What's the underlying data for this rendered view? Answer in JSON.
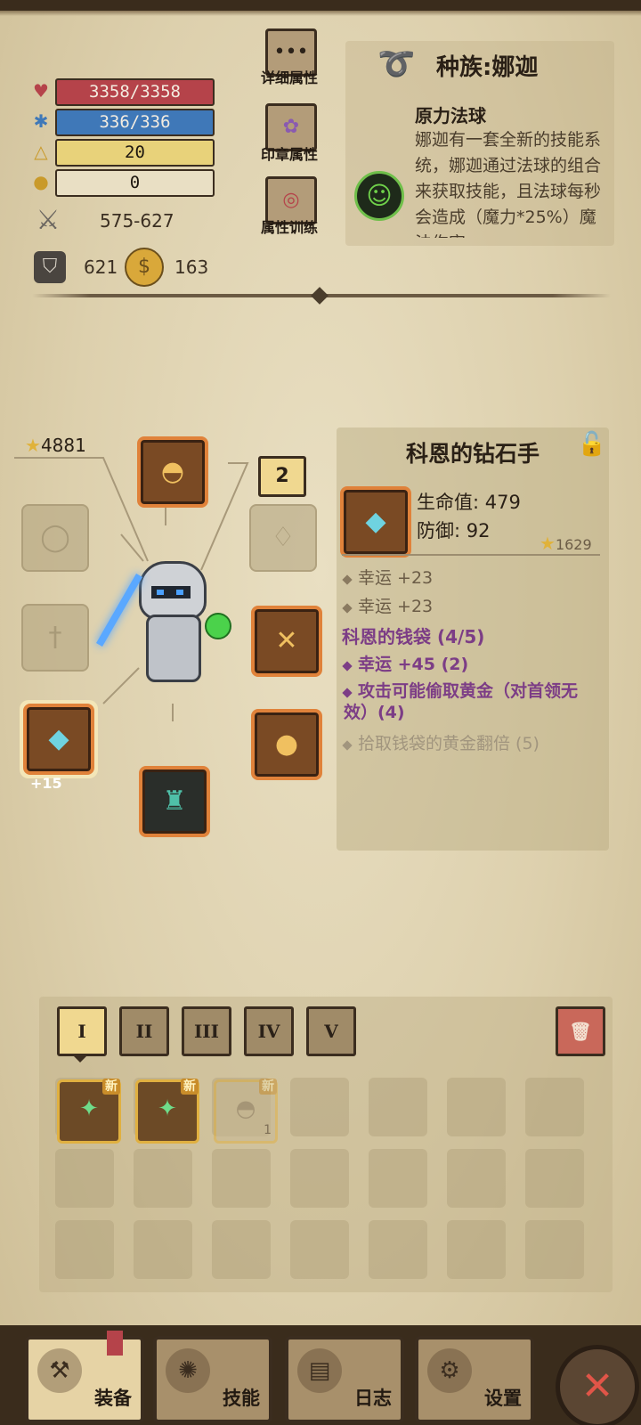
{
  "stats": {
    "hp": "3358/3358",
    "mp": "336/336",
    "level": "20",
    "points": "0",
    "attack": "575-627",
    "defense": "621",
    "gold": "163"
  },
  "actions": [
    {
      "label": "详细属性",
      "icon": "ellipsis-icon"
    },
    {
      "label": "印章属性",
      "icon": "rune-icon"
    },
    {
      "label": "属性训练",
      "icon": "target-icon"
    }
  ],
  "race": {
    "title": "种族:娜迦",
    "skill_name": "原力法球",
    "description": "娜迦有一套全新的技能系统，娜迦通过法球的组合来获取技能，且法球每秒会造成（魔力*25%）魔法伤害"
  },
  "hero": {
    "power": "4881",
    "queue_badge": "2",
    "selected_slot_level": "+15"
  },
  "item": {
    "name": "科恩的钻石手",
    "hp_label": "生命值: 479",
    "def_label": "防御: 92",
    "score": "1629",
    "attributes": [
      "幸运 +23",
      "幸运 +23"
    ],
    "set_title": "科恩的钱袋 (4/5)",
    "set_bonuses": [
      {
        "text": "幸运 +45 (2)",
        "active": true
      },
      {
        "text": "攻击可能偷取黄金（对首领无效）(4)",
        "active": true
      },
      {
        "text": "拾取钱袋的黄金翻倍 (5)",
        "active": false
      }
    ]
  },
  "inventory": {
    "tabs": [
      "I",
      "II",
      "III",
      "IV",
      "V"
    ],
    "active_tab": 0,
    "new_badge": "新",
    "stack_count": "1"
  },
  "nav": [
    {
      "label": "装备",
      "icon": "axe-icon",
      "active": true
    },
    {
      "label": "技能",
      "icon": "skill-icon",
      "active": false
    },
    {
      "label": "日志",
      "icon": "log-icon",
      "active": false
    },
    {
      "label": "设置",
      "icon": "gear-icon",
      "active": false
    }
  ],
  "colors": {
    "hp": "#b5434a",
    "mp": "#3f78b8",
    "level": "#e8d27a",
    "points": "#e9dfc4",
    "set": "#7c3d86",
    "slot_border": "#e0823a"
  }
}
